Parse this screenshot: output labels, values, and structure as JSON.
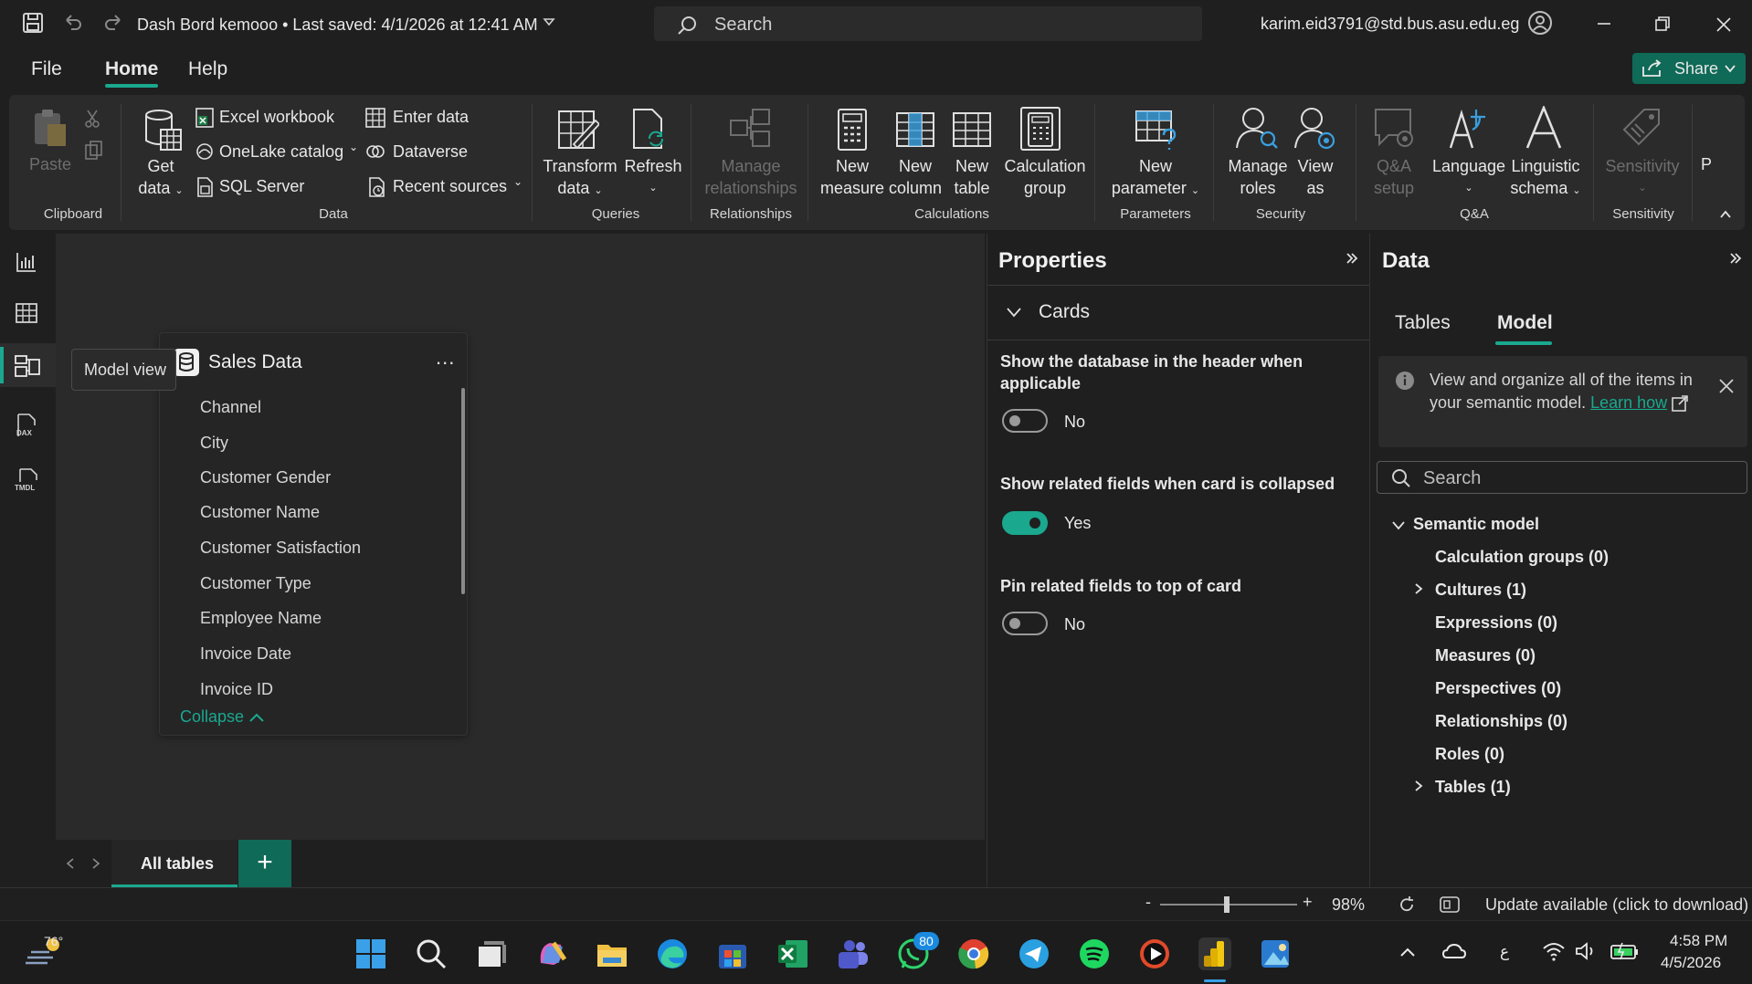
{
  "titlebar": {
    "doc_title": "Dash Bord kemooo • Last saved: 4/1/2026 at 12:41 AM",
    "search_placeholder": "Search",
    "account": "karim.eid3791@std.bus.asu.edu.eg"
  },
  "menu": {
    "file": "File",
    "home": "Home",
    "help": "Help",
    "share": "Share"
  },
  "ribbon": {
    "paste": "Paste",
    "clipboard_group": "Clipboard",
    "get_data_1": "Get",
    "get_data_2": "data",
    "excel": "Excel workbook",
    "onelake": "OneLake catalog",
    "sql": "SQL Server",
    "enter_data": "Enter data",
    "dataverse": "Dataverse",
    "recent": "Recent sources",
    "data_group": "Data",
    "transform_1": "Transform",
    "transform_2": "data",
    "refresh": "Refresh",
    "queries_group": "Queries",
    "manage_rel_1": "Manage",
    "manage_rel_2": "relationships",
    "relationships_group": "Relationships",
    "new_measure_1": "New",
    "new_measure_2": "measure",
    "new_column_1": "New",
    "new_column_2": "column",
    "new_table_1": "New",
    "new_table_2": "table",
    "calc_group_1": "Calculation",
    "calc_group_2": "group",
    "calculations_group": "Calculations",
    "new_param_1": "New",
    "new_param_2": "parameter",
    "parameters_group": "Parameters",
    "manage_roles_1": "Manage",
    "manage_roles_2": "roles",
    "view_as_1": "View",
    "view_as_2": "as",
    "security_group": "Security",
    "qa_setup_1": "Q&A",
    "qa_setup_2": "setup",
    "language": "Language",
    "linguistic_1": "Linguistic",
    "linguistic_2": "schema",
    "qa_group": "Q&A",
    "sensitivity": "Sensitivity",
    "sensitivity_group": "Sensitivity",
    "publish_cut": "P"
  },
  "canvas": {
    "tooltip": "Model view",
    "card_title": "Sales Data",
    "card_more": "...",
    "fields": [
      "Channel",
      "City",
      "Customer Gender",
      "Customer Name",
      "Customer Satisfaction",
      "Customer Type",
      "Employee Name",
      "Invoice Date",
      "Invoice ID"
    ],
    "collapse": "Collapse",
    "tab_all": "All tables",
    "tab_add": "+"
  },
  "properties": {
    "title": "Properties",
    "section": "Cards",
    "opt1_label": "Show the database in the header when applicable",
    "opt1_value": "No",
    "opt2_label": "Show related fields when card is collapsed",
    "opt2_value": "Yes",
    "opt3_label": "Pin related fields to top of card",
    "opt3_value": "No"
  },
  "data": {
    "title": "Data",
    "tab_tables": "Tables",
    "tab_model": "Model",
    "info_text": "View and organize all of the items in your semantic model.",
    "info_link": "Learn how",
    "search_placeholder": "Search",
    "root": "Semantic model",
    "items": [
      "Calculation groups (0)",
      "Cultures (1)",
      "Expressions (0)",
      "Measures (0)",
      "Perspectives (0)",
      "Relationships (0)",
      "Roles (0)",
      "Tables (1)"
    ]
  },
  "status": {
    "zoom": "98%",
    "update": "Update available (click to download)",
    "zoom_minus": "-",
    "zoom_plus": "+"
  },
  "taskbar": {
    "weather": "76°",
    "badge": "80",
    "time": "4:58 PM",
    "date": "4/5/2026",
    "lang": "ع"
  },
  "colors": {
    "accent": "#1aa88f",
    "accent_dark": "#0f6a57",
    "background": "#1f1f1f",
    "canvas": "#2a2a2a"
  }
}
